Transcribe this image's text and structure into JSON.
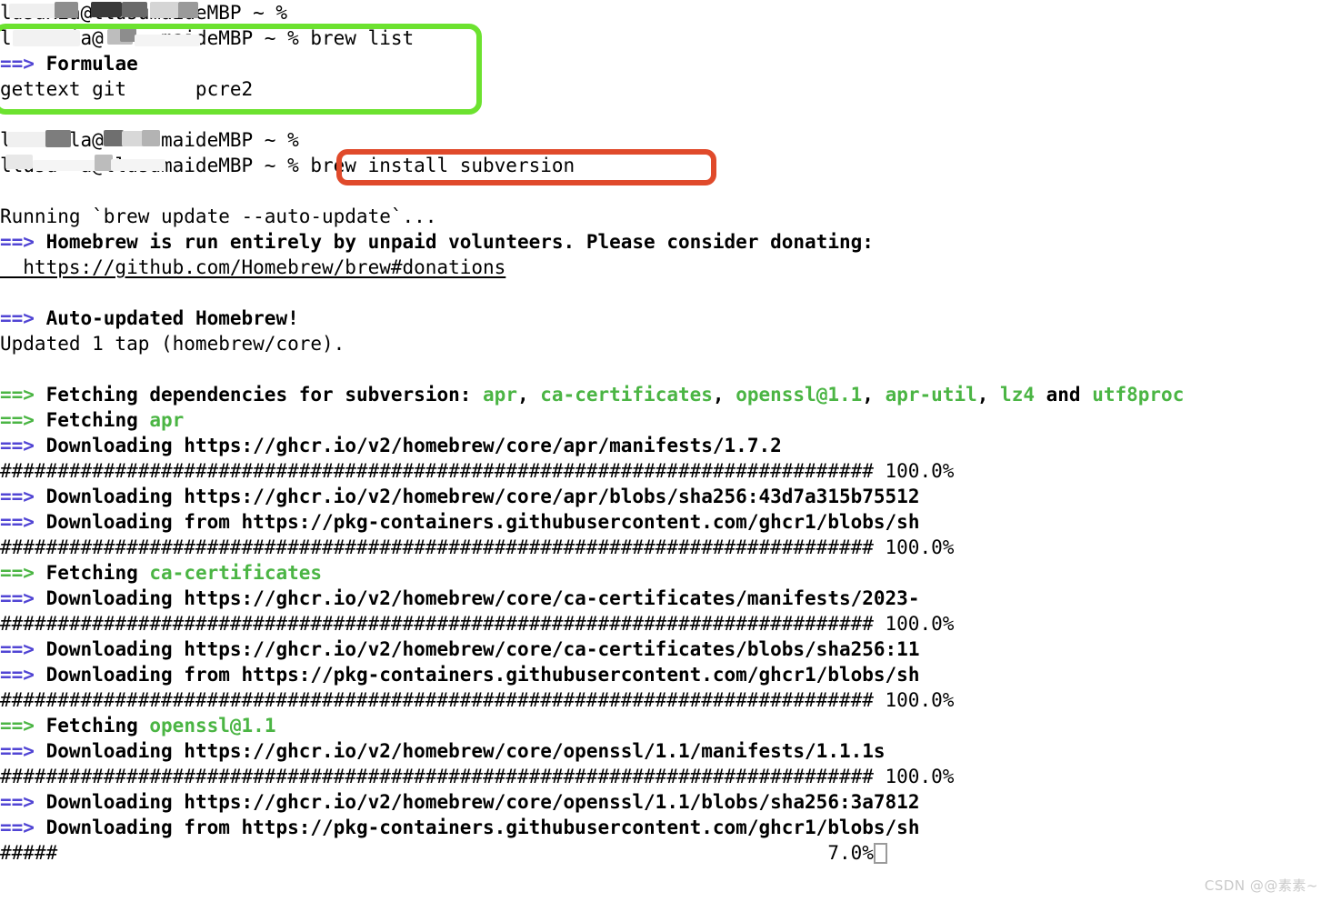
{
  "terminal": {
    "prompt_suffix": "maideMBP ~ %",
    "lines": [
      {
        "id": "l1",
        "type": "prompt",
        "prompt": "lusuxia@llusumaideMBP ~ %",
        "command": ""
      },
      {
        "id": "l2",
        "type": "prompt",
        "prompt": "l     ia@     maideMBP ~ %",
        "command": " brew list"
      },
      {
        "id": "l3",
        "type": "arrow",
        "arrow": "==>",
        "arrow_color": "purple",
        "text": "Formulae",
        "bold": true
      },
      {
        "id": "l4",
        "type": "plain",
        "text": "gettext git      pcre2"
      },
      {
        "id": "l5",
        "type": "blank",
        "text": ""
      },
      {
        "id": "l6",
        "type": "prompt",
        "prompt": "l     la@l    maideMBP ~ %",
        "command": ""
      },
      {
        "id": "l7",
        "type": "prompt",
        "prompt": "llusu  a@llusumaideMBP ~ %",
        "command": " brew install subversion"
      },
      {
        "id": "l8",
        "type": "blank",
        "text": ""
      },
      {
        "id": "l9",
        "type": "plain",
        "text": "Running `brew update --auto-update`..."
      },
      {
        "id": "l10",
        "type": "arrow",
        "arrow": "==>",
        "arrow_color": "purple",
        "text": "Homebrew is run entirely by unpaid volunteers. Please consider donating:",
        "bold": true
      },
      {
        "id": "l11",
        "type": "link",
        "text": "  https://github.com/Homebrew/brew#donations"
      },
      {
        "id": "l12",
        "type": "blank",
        "text": ""
      },
      {
        "id": "l13",
        "type": "arrow",
        "arrow": "==>",
        "arrow_color": "purple",
        "text": "Auto-updated Homebrew!",
        "bold": true
      },
      {
        "id": "l14",
        "type": "plain",
        "text": "Updated 1 tap (homebrew/core)."
      },
      {
        "id": "l15",
        "type": "blank",
        "text": ""
      },
      {
        "id": "l16",
        "type": "deps",
        "arrow": "==>",
        "arrow_color": "green",
        "prefix": "Fetching dependencies for subversion: ",
        "packages": [
          "apr",
          "ca-certificates",
          "openssl@1.1",
          "apr-util",
          "lz4"
        ],
        "conjunction": " and ",
        "last_package": "utf8proc"
      },
      {
        "id": "l17",
        "type": "fetch",
        "arrow": "==>",
        "arrow_color": "green",
        "prefix": "Fetching ",
        "package": "apr"
      },
      {
        "id": "l18",
        "type": "arrow",
        "arrow": "==>",
        "arrow_color": "purple",
        "text": "Downloading https://ghcr.io/v2/homebrew/core/apr/manifests/1.7.2",
        "bold": true
      },
      {
        "id": "l19",
        "type": "progress",
        "hashes": 76,
        "percent": "100.0%"
      },
      {
        "id": "l20",
        "type": "arrow",
        "arrow": "==>",
        "arrow_color": "purple",
        "text": "Downloading https://ghcr.io/v2/homebrew/core/apr/blobs/sha256:43d7a315b75512",
        "bold": true
      },
      {
        "id": "l21",
        "type": "arrow",
        "arrow": "==>",
        "arrow_color": "purple",
        "text": "Downloading from https://pkg-containers.githubusercontent.com/ghcr1/blobs/sh",
        "bold": true
      },
      {
        "id": "l22",
        "type": "progress",
        "hashes": 76,
        "percent": "100.0%"
      },
      {
        "id": "l23",
        "type": "fetch",
        "arrow": "==>",
        "arrow_color": "green",
        "prefix": "Fetching ",
        "package": "ca-certificates"
      },
      {
        "id": "l24",
        "type": "arrow",
        "arrow": "==>",
        "arrow_color": "purple",
        "text": "Downloading https://ghcr.io/v2/homebrew/core/ca-certificates/manifests/2023-",
        "bold": true
      },
      {
        "id": "l25",
        "type": "progress",
        "hashes": 76,
        "percent": "100.0%"
      },
      {
        "id": "l26",
        "type": "arrow",
        "arrow": "==>",
        "arrow_color": "purple",
        "text": "Downloading https://ghcr.io/v2/homebrew/core/ca-certificates/blobs/sha256:11",
        "bold": true
      },
      {
        "id": "l27",
        "type": "arrow",
        "arrow": "==>",
        "arrow_color": "purple",
        "text": "Downloading from https://pkg-containers.githubusercontent.com/ghcr1/blobs/sh",
        "bold": true
      },
      {
        "id": "l28",
        "type": "progress",
        "hashes": 76,
        "percent": "100.0%"
      },
      {
        "id": "l29",
        "type": "fetch",
        "arrow": "==>",
        "arrow_color": "green",
        "prefix": "Fetching ",
        "package": "openssl@1.1"
      },
      {
        "id": "l30",
        "type": "arrow",
        "arrow": "==>",
        "arrow_color": "purple",
        "text": "Downloading https://ghcr.io/v2/homebrew/core/openssl/1.1/manifests/1.1.1s",
        "bold": true
      },
      {
        "id": "l31",
        "type": "progress",
        "hashes": 76,
        "percent": "100.0%"
      },
      {
        "id": "l32",
        "type": "arrow",
        "arrow": "==>",
        "arrow_color": "purple",
        "text": "Downloading https://ghcr.io/v2/homebrew/core/openssl/1.1/blobs/sha256:3a7812",
        "bold": true
      },
      {
        "id": "l33",
        "type": "arrow",
        "arrow": "==>",
        "arrow_color": "purple",
        "text": "Downloading from https://pkg-containers.githubusercontent.com/ghcr1/blobs/sh",
        "bold": true
      },
      {
        "id": "l34",
        "type": "progress_cursor",
        "hashes": 5,
        "percent": "7.0%",
        "pad_to": 76
      }
    ]
  },
  "annotations": {
    "green_box": {
      "label": "brew-list-output-highlight",
      "color": "#6ce22f"
    },
    "red_box": {
      "label": "brew-install-command-highlight",
      "color": "#e04a2b"
    }
  },
  "watermark": {
    "text": "CSDN @@素素~",
    "color": "#c9c9c9"
  }
}
